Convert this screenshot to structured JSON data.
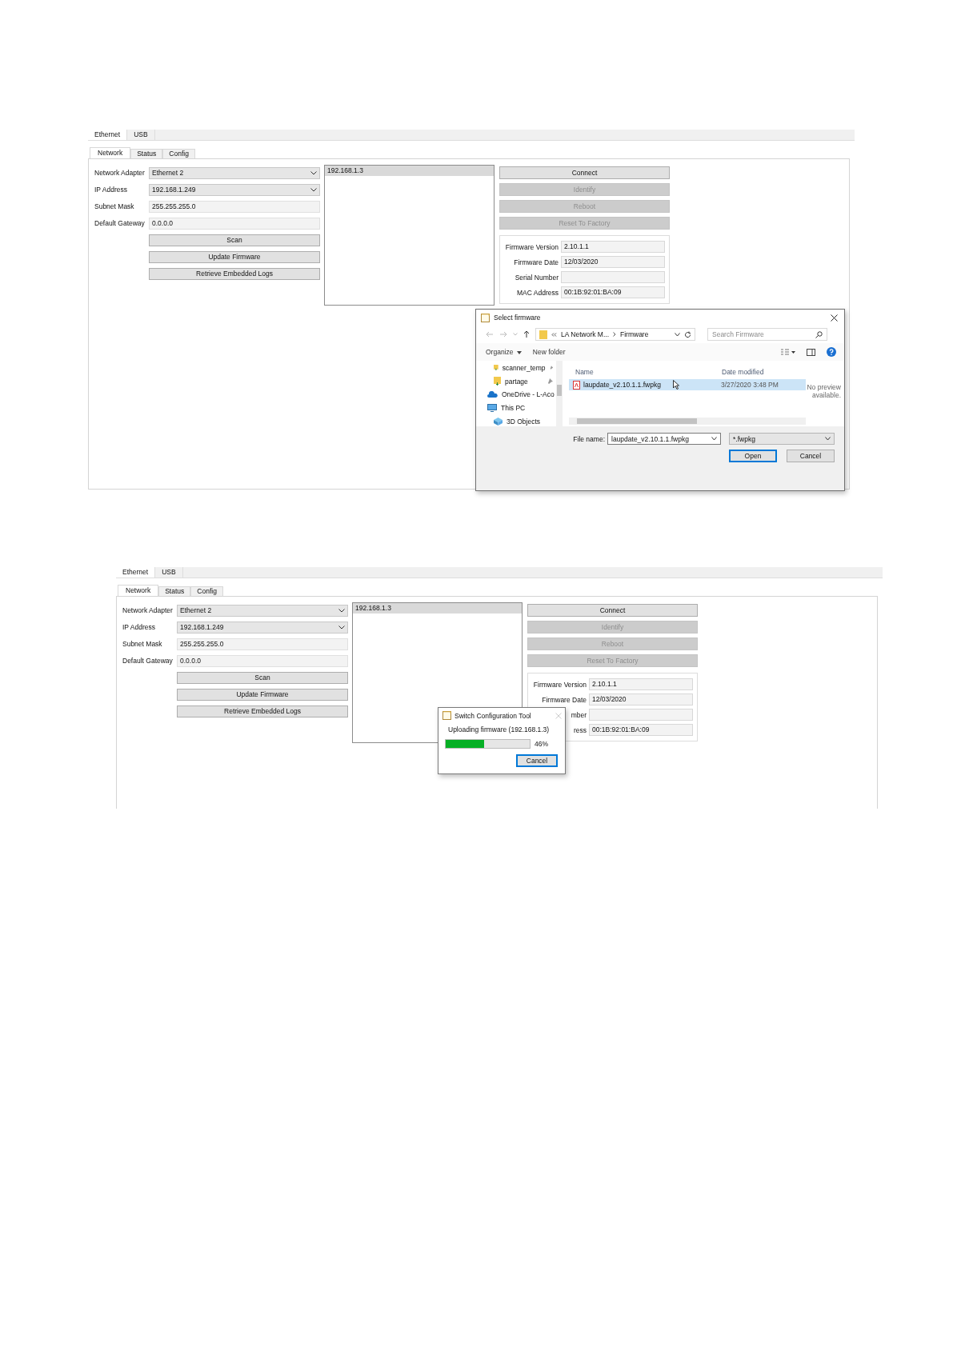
{
  "screenshots": [
    {
      "outer_tabs": [
        {
          "label": "Ethernet",
          "selected": true
        },
        {
          "label": "USB",
          "selected": false
        }
      ],
      "inner_tabs": [
        {
          "label": "Network",
          "selected": true
        },
        {
          "label": "Status",
          "selected": false
        },
        {
          "label": "Config",
          "selected": false
        }
      ],
      "fields": [
        {
          "label": "Network Adapter",
          "value": "Ethernet 2",
          "kind": "dropdown"
        },
        {
          "label": "IP Address",
          "value": "192.168.1.249",
          "kind": "dropdown"
        },
        {
          "label": "Subnet Mask",
          "value": "255.255.255.0",
          "kind": "text"
        },
        {
          "label": "Default Gateway",
          "value": "0.0.0.0",
          "kind": "text"
        }
      ],
      "actions": [
        "Scan",
        "Update Firmware",
        "Retrieve Embedded Logs"
      ],
      "devices": [
        {
          "text": "192.168.1.3",
          "selected": true
        }
      ],
      "device_buttons": [
        {
          "label": "Connect",
          "disabled": false
        },
        {
          "label": "Identify",
          "disabled": true
        },
        {
          "label": "Reboot",
          "disabled": true
        },
        {
          "label": "Reset To Factory",
          "disabled": true
        }
      ],
      "info": [
        {
          "label": "Firmware Version",
          "value": "2.10.1.1"
        },
        {
          "label": "Firmware Date",
          "value": "12/03/2020"
        },
        {
          "label": "Serial Number"
        },
        {
          "label": "MAC Address",
          "value": "00:1B:92:01:BA:09"
        }
      ],
      "dialog": {
        "kind": "file",
        "title": "Select firmware",
        "path": [
          "LA Network M...",
          "Firmware"
        ],
        "search_placeholder": "Search Firmware",
        "toolbar": [
          "Organize",
          "New folder"
        ],
        "nav_items": [
          {
            "label": "scanner_temp",
            "kind": "folder",
            "pinned": true
          },
          {
            "label": "partage",
            "kind": "folder",
            "pinned": true
          },
          {
            "label": "OneDrive - L-Aco",
            "kind": "cloud"
          },
          {
            "label": "This PC",
            "kind": "pc"
          },
          {
            "label": "3D Objects",
            "kind": "cube"
          }
        ],
        "columns": [
          "Name",
          "Date modified"
        ],
        "files": [
          {
            "name": "laupdate_v2.10.1.1.fwpkg",
            "date": "3/27/2020 3:48 PM",
            "selected": true
          }
        ],
        "preview": "No preview available.",
        "file_name_label": "File name:",
        "file_name": "laupdate_v2.10.1.1.fwpkg",
        "filter": "*.fwpkg",
        "buttons": [
          "Open",
          "Cancel"
        ]
      }
    },
    {
      "outer_tabs": [
        {
          "label": "Ethernet",
          "selected": true
        },
        {
          "label": "USB",
          "selected": false
        }
      ],
      "inner_tabs": [
        {
          "label": "Network",
          "selected": true
        },
        {
          "label": "Status",
          "selected": false
        },
        {
          "label": "Config",
          "selected": false
        }
      ],
      "fields": [
        {
          "label": "Network Adapter",
          "value": "Ethernet 2",
          "kind": "dropdown"
        },
        {
          "label": "IP Address",
          "value": "192.168.1.249",
          "kind": "dropdown"
        },
        {
          "label": "Subnet Mask",
          "value": "255.255.255.0",
          "kind": "text"
        },
        {
          "label": "Default Gateway",
          "value": "0.0.0.0",
          "kind": "text"
        }
      ],
      "actions": [
        "Scan",
        "Update Firmware",
        "Retrieve Embedded Logs"
      ],
      "devices": [
        {
          "text": "192.168.1.3",
          "selected": true
        }
      ],
      "device_buttons": [
        {
          "label": "Connect",
          "disabled": false
        },
        {
          "label": "Identify",
          "disabled": true
        },
        {
          "label": "Reboot",
          "disabled": true
        },
        {
          "label": "Reset To Factory",
          "disabled": true
        }
      ],
      "info": [
        {
          "label": "Firmware Version",
          "value": "2.10.1.1"
        },
        {
          "label": "Firmware Date",
          "value": "12/03/2020"
        },
        {
          "label": "mber"
        },
        {
          "label": "ress",
          "value": "00:1B:92:01:BA:09"
        }
      ],
      "dialog": {
        "kind": "progress",
        "title": "Switch Configuration Tool",
        "message": "Uploading firmware (192.168.1.3)",
        "level": 0.46,
        "reading": "46%",
        "buttons": [
          "Cancel"
        ]
      }
    }
  ]
}
